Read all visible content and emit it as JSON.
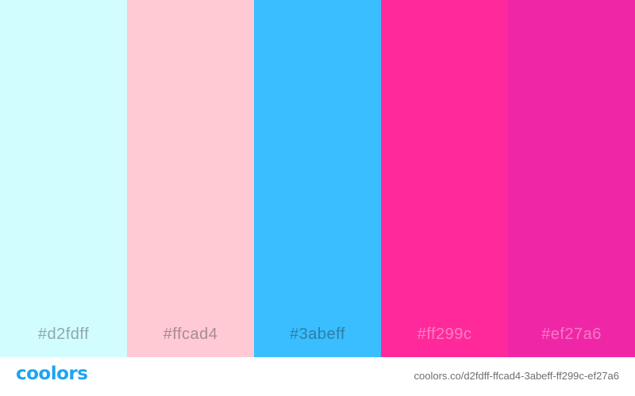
{
  "palette": [
    {
      "hex": "#d2fdff",
      "label": "#d2fdff",
      "label_color": "#8fa8aa"
    },
    {
      "hex": "#ffcad4",
      "label": "#ffcad4",
      "label_color": "#a98b91"
    },
    {
      "hex": "#3abeff",
      "label": "#3abeff",
      "label_color": "#2d7fa9"
    },
    {
      "hex": "#ff299c",
      "label": "#ff299c",
      "label_color": "#ff7fc2"
    },
    {
      "hex": "#ef27a6",
      "label": "#ef27a6",
      "label_color": "#f479c7"
    }
  ],
  "footer": {
    "logo": "coolors",
    "logo_color": "#1fa3f0",
    "url": "coolors.co/d2fdff-ffcad4-3abeff-ff299c-ef27a6"
  }
}
